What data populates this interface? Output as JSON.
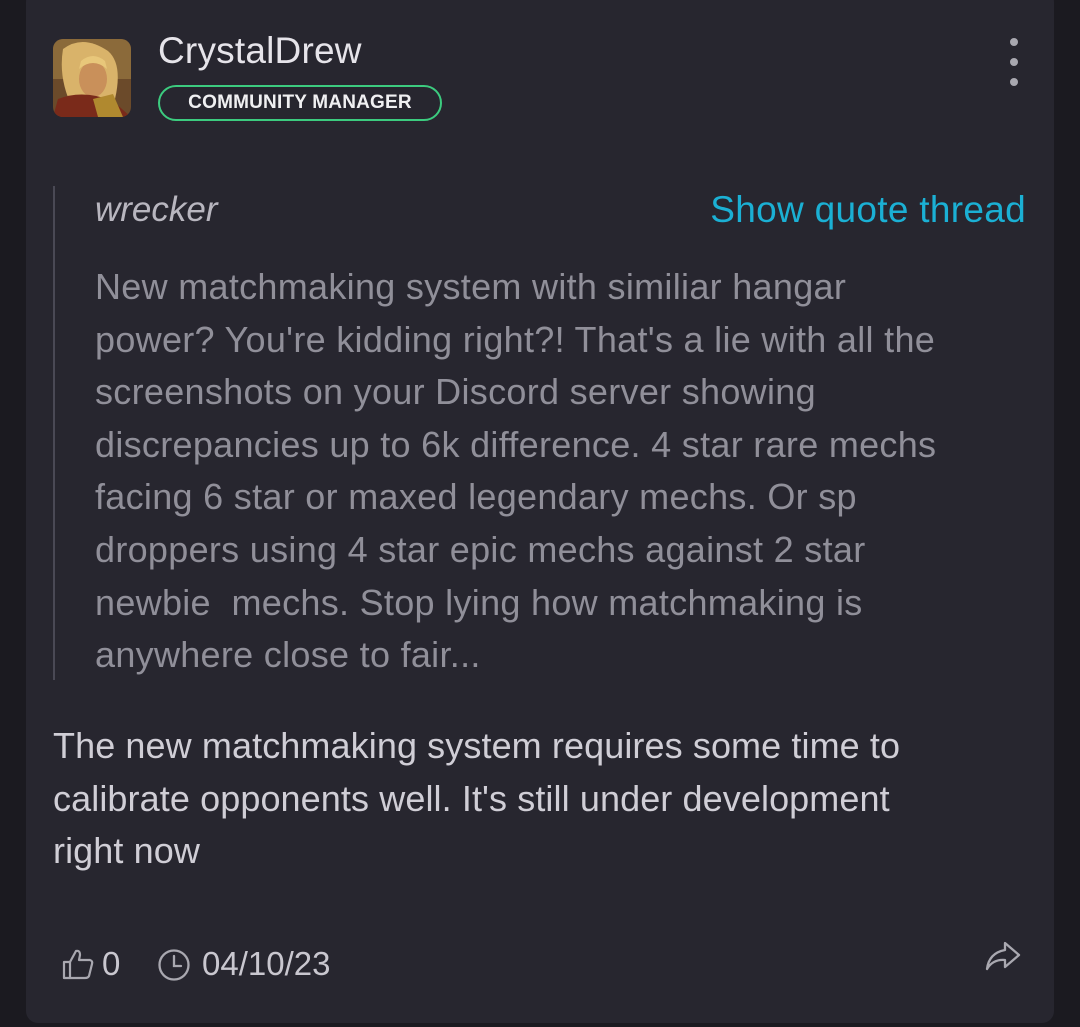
{
  "post": {
    "author": "CrystalDrew",
    "role_badge": "COMMUNITY MANAGER",
    "avatar_icon": "hero-avatar-icon",
    "quote": {
      "author": "wrecker",
      "show_thread_label": "Show quote thread",
      "text": "New matchmaking system with similiar hangar\npower? You're kidding right?! That's a lie with all the\nscreenshots on your Discord server showing\ndiscrepancies up to 6k difference. 4 star rare mechs\nfacing 6 star or maxed legendary mechs. Or sp\ndroppers using 4 star epic mechs against 2 star\nnewbie  mechs. Stop lying how matchmaking is\nanywhere close to fair..."
    },
    "body": "The new matchmaking system requires some time to\ncalibrate opponents well. It's still under development\nright now",
    "likes": "0",
    "date": "04/10/23"
  },
  "colors": {
    "background": "#1b1a20",
    "card": "#27262f",
    "accent_link": "#1bb0d4",
    "badge_border": "#3ccb7f"
  }
}
